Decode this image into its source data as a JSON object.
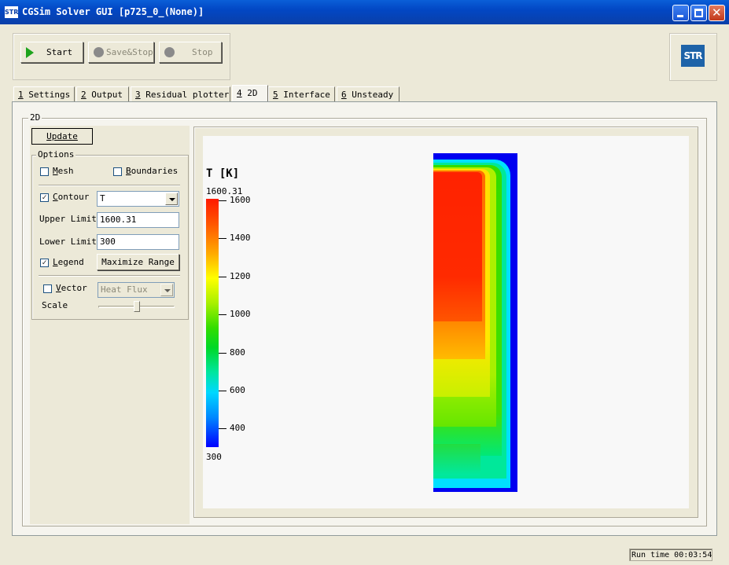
{
  "window": {
    "title": "CGSim Solver GUI [p725_0_(None)]",
    "app_icon_text": "STR",
    "controls": [
      "minimize",
      "maximize",
      "close"
    ]
  },
  "toolbar": {
    "start_label": "Start",
    "savestop_label": "Save&Stop",
    "stop_label": "Stop",
    "logo_text": "STR"
  },
  "tabs": [
    {
      "key": "1",
      "label": " Settings"
    },
    {
      "key": "2",
      "label": " Output"
    },
    {
      "key": "3",
      "label": " Residual plotter"
    },
    {
      "key": "4",
      "label": " 2D",
      "active": true
    },
    {
      "key": "5",
      "label": " Interface"
    },
    {
      "key": "6",
      "label": " Unsteady"
    }
  ],
  "panel": {
    "group_label": "2D",
    "update_label": "Update",
    "options_label": "Options",
    "mesh_label": "Mesh",
    "mesh_checked": false,
    "boundaries_label": "Boundaries",
    "boundaries_checked": false,
    "contour_label": "Contour",
    "contour_checked": true,
    "contour_variable": "T",
    "upper_limit_label": "Upper Limit",
    "upper_limit_value": "1600.31",
    "lower_limit_label": "Lower Limit",
    "lower_limit_value": "300",
    "legend_label": "Legend",
    "legend_checked": true,
    "maximize_range_label": "Maximize Range",
    "vector_label": "Vector",
    "vector_checked": false,
    "vector_variable": "Heat Flux",
    "scale_label": "Scale",
    "scale_value": 0.5
  },
  "colorbar": {
    "title": "T [K]",
    "max_label": "1600.31",
    "min_label": "300",
    "ticks": [
      "1600",
      "1400",
      "1200",
      "1000",
      "800",
      "600",
      "400"
    ]
  },
  "colors": {
    "xp_blue": "#0247c4",
    "face": "#ece9d8"
  },
  "status": {
    "runtime_text": "Run time 00:03:54"
  }
}
